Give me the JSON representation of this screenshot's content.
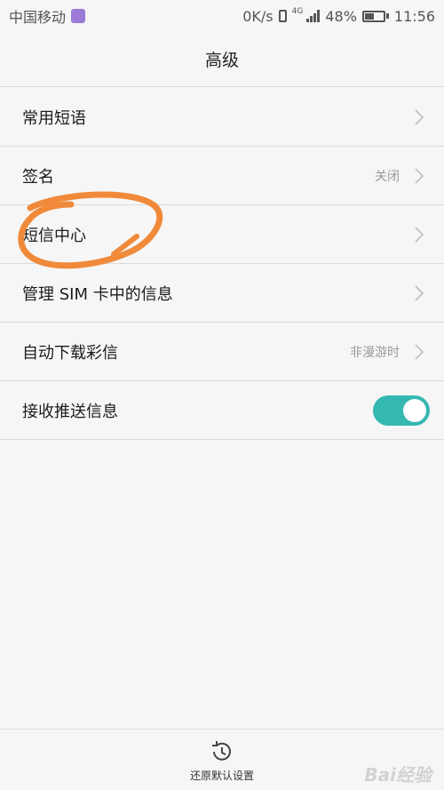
{
  "status_bar": {
    "carrier": "中国移动",
    "speed": "0K/s",
    "network": "4G",
    "battery_percent": "48%",
    "battery_level": 0.48,
    "time": "11:56"
  },
  "header": {
    "title": "高级"
  },
  "settings": {
    "rows": [
      {
        "label": "常用短语",
        "value": ""
      },
      {
        "label": "签名",
        "value": "关闭"
      },
      {
        "label": "短信中心",
        "value": ""
      },
      {
        "label": "管理 SIM 卡中的信息",
        "value": ""
      },
      {
        "label": "自动下载彩信",
        "value": "非漫游时"
      },
      {
        "label": "接收推送信息",
        "toggle_on": true
      }
    ]
  },
  "footer": {
    "restore_label": "还原默认设置"
  },
  "watermark": "Bai经验",
  "colors": {
    "accent": "#34b8b1",
    "annotation": "#f08a3a"
  }
}
